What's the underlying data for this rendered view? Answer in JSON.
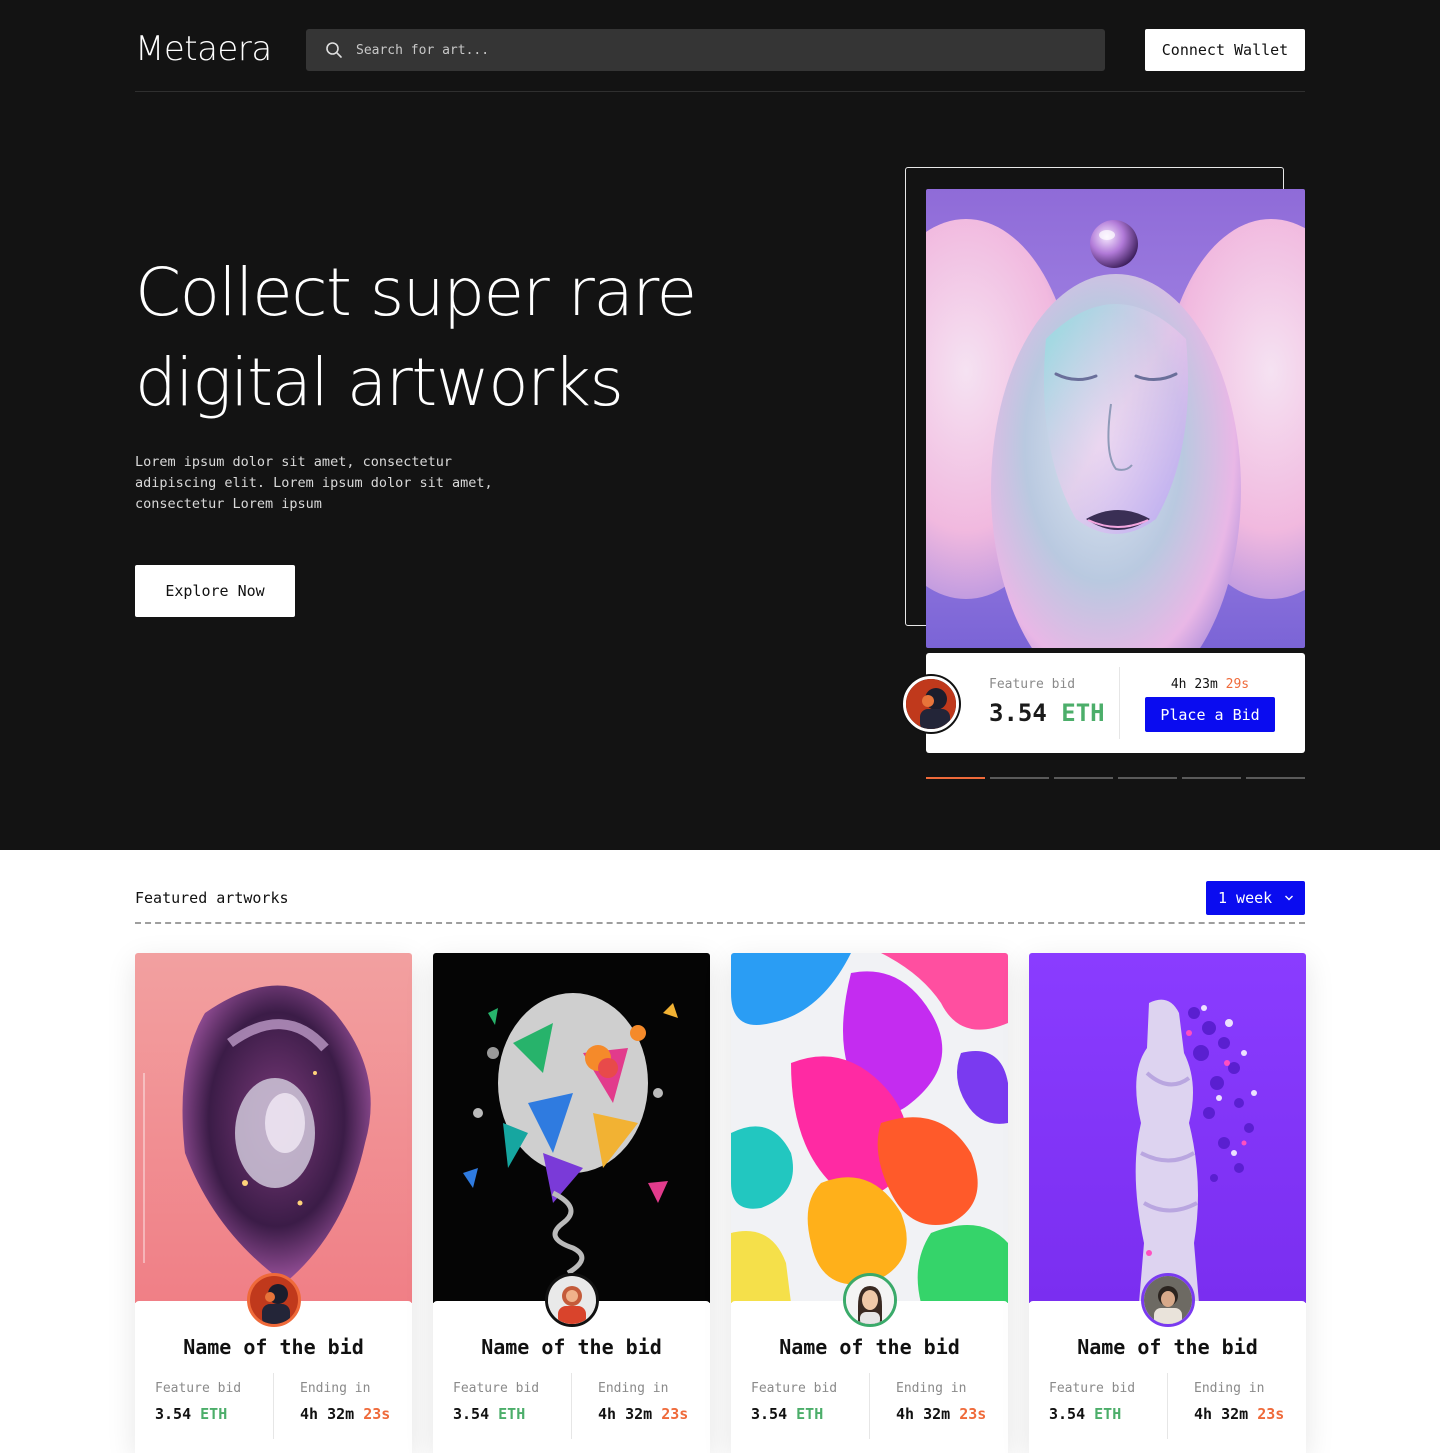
{
  "header": {
    "logo": "Metaera",
    "search_placeholder": "Search for art...",
    "connect_label": "Connect Wallet"
  },
  "hero": {
    "headline_line1": "Collect super rare",
    "headline_line2": "digital artworks",
    "lead": "Lorem ipsum dolor sit amet, consectetur adipiscing elit. Lorem ipsum dolor sit amet, consectetur Lorem ipsum",
    "explore_label": "Explore Now",
    "bid": {
      "label": "Feature bid",
      "amount": "3.54",
      "currency": "ETH",
      "timer_main": "4h 23m",
      "timer_sec": "29s",
      "place_label": "Place a Bid"
    },
    "slides_total": 6,
    "slide_active": 1
  },
  "featured": {
    "title": "Featured artworks",
    "period_label": "1 week",
    "cards": [
      {
        "name": "Name of the bid",
        "bid_label": "Feature bid",
        "amount": "3.54",
        "currency": "ETH",
        "end_label": "Ending in",
        "end_main": "4h 32m",
        "end_sec": "23s"
      },
      {
        "name": "Name of the bid",
        "bid_label": "Feature bid",
        "amount": "3.54",
        "currency": "ETH",
        "end_label": "Ending in",
        "end_main": "4h 32m",
        "end_sec": "23s"
      },
      {
        "name": "Name of the bid",
        "bid_label": "Feature bid",
        "amount": "3.54",
        "currency": "ETH",
        "end_label": "Ending in",
        "end_main": "4h 32m",
        "end_sec": "23s"
      },
      {
        "name": "Name of the bid",
        "bid_label": "Feature bid",
        "amount": "3.54",
        "currency": "ETH",
        "end_label": "Ending in",
        "end_main": "4h 32m",
        "end_sec": "23s"
      }
    ]
  },
  "colors": {
    "accent_blue": "#0a0cf0",
    "eth_green": "#4cae6a",
    "seconds_orange": "#ef6a3a",
    "hero_bg": "#131313"
  },
  "icons": {
    "search": "search-icon",
    "chevron": "chevron-down-icon"
  }
}
